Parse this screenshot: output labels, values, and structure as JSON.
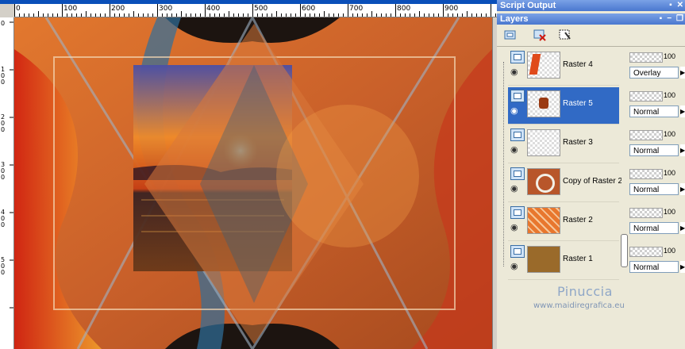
{
  "ruler": {
    "h_labels": [
      "0",
      "100",
      "200",
      "300",
      "400",
      "500",
      "600",
      "700",
      "800",
      "900"
    ],
    "v_labels": [
      "0",
      "1\n0\n0",
      "2\n0\n0",
      "3\n0\n0",
      "4\n0\n0",
      "5\n0\n0"
    ]
  },
  "palettes": {
    "script_output_title": "Script Output",
    "layers_title": "Layers"
  },
  "layers": [
    {
      "name": "Raster 4",
      "opacity": "100",
      "blend": "Overlay",
      "selected": false
    },
    {
      "name": "Raster 5",
      "opacity": "100",
      "blend": "Normal",
      "selected": true
    },
    {
      "name": "Raster 3",
      "opacity": "100",
      "blend": "Normal",
      "selected": false
    },
    {
      "name": "Copy of Raster 2",
      "opacity": "100",
      "blend": "Normal",
      "selected": false
    },
    {
      "name": "Raster 2",
      "opacity": "100",
      "blend": "Normal",
      "selected": false
    },
    {
      "name": "Raster 1",
      "opacity": "100",
      "blend": "Normal",
      "selected": false
    }
  ],
  "watermark": {
    "name": "Pinuccia",
    "url": "www.maidiregrafica.eu"
  },
  "colors": {
    "accent": "#316ac5",
    "title_bar": "#4a77cf"
  },
  "icons": [
    "new-layer-icon",
    "delete-layer-icon",
    "mask-icon",
    "eye-icon",
    "raster-layer-icon"
  ]
}
